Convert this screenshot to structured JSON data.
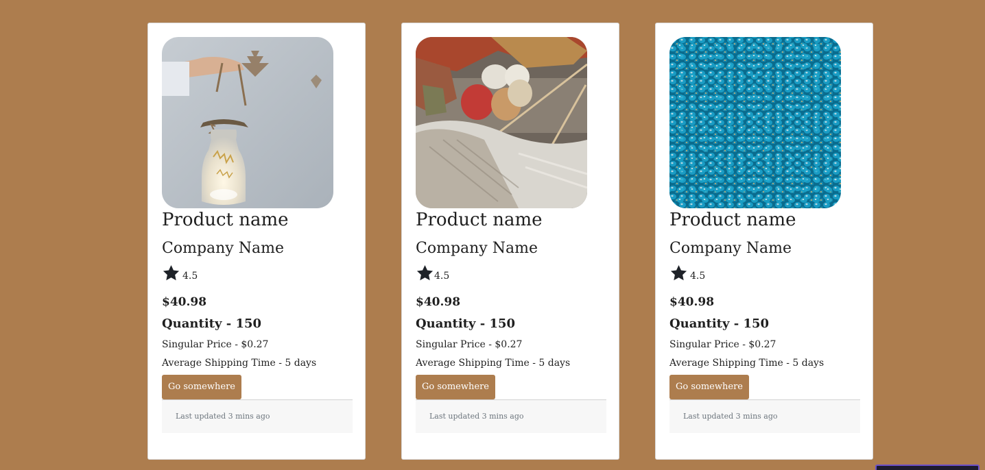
{
  "theme": {
    "background": "#ad7d4e",
    "button": "#ad7d4e",
    "card": "#ffffff",
    "footer": "#f7f7f7"
  },
  "cards": [
    {
      "image": "glass-jar-lantern-photo",
      "product_name": "Product name",
      "company_name": "Company Name",
      "rating": "4.5",
      "price": "$40.98",
      "quantity": "Quantity - 150",
      "singular_price": "Singular Price - $0.27",
      "shipping": "Average Shipping Time - 5 days",
      "button_label": "Go somewhere",
      "footer": "Last updated 3 mins ago"
    },
    {
      "image": "yarn-balls-knitting-photo",
      "product_name": "Product name",
      "company_name": "Company Name",
      "rating": "4.5",
      "price": "$40.98",
      "quantity": "Quantity - 150",
      "singular_price": "Singular Price - $0.27",
      "shipping": "Average Shipping Time - 5 days",
      "button_label": "Go somewhere",
      "footer": "Last updated 3 mins ago"
    },
    {
      "image": "blue-beads-photo",
      "product_name": "Product name",
      "company_name": "Company Name",
      "rating": "4.5",
      "price": "$40.98",
      "quantity": "Quantity - 150",
      "singular_price": "Singular Price - $0.27",
      "shipping": "Average Shipping Time - 5 days",
      "button_label": "Go somewhere",
      "footer": "Last updated 3 mins ago"
    }
  ]
}
